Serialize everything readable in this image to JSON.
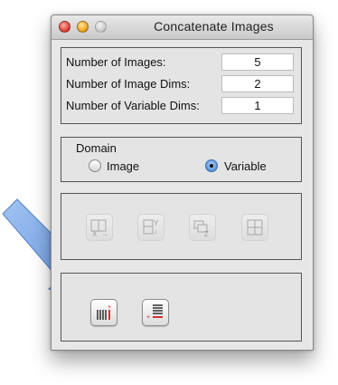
{
  "window": {
    "title": "Concatenate Images"
  },
  "params": {
    "rows": [
      {
        "label": "Number of Images:",
        "value": "5"
      },
      {
        "label": "Number of Image Dims:",
        "value": "2"
      },
      {
        "label": "Number of Variable Dims:",
        "value": "1"
      }
    ]
  },
  "domain": {
    "label": "Domain",
    "options": [
      {
        "label": "Image",
        "selected": false
      },
      {
        "label": "Variable",
        "selected": true
      }
    ]
  },
  "dimension_buttons": [
    {
      "icon": "concat-x-icon",
      "enabled": false
    },
    {
      "icon": "concat-y-icon",
      "enabled": false
    },
    {
      "icon": "concat-z-icon",
      "enabled": false
    },
    {
      "icon": "grid-tile-icon",
      "enabled": false
    }
  ],
  "variable_buttons": [
    {
      "icon": "append-variable-column-icon",
      "enabled": true
    },
    {
      "icon": "append-variable-row-icon",
      "enabled": true
    }
  ],
  "annotation": {
    "icon": "pointer-arrow-icon",
    "color": "#6f9fe6"
  },
  "colors": {
    "window_bg": "#e7e7e7",
    "close": "#e2463a",
    "minimize": "#f0a91e",
    "accent": "#5c97dc",
    "red_mark": "#d22020"
  }
}
